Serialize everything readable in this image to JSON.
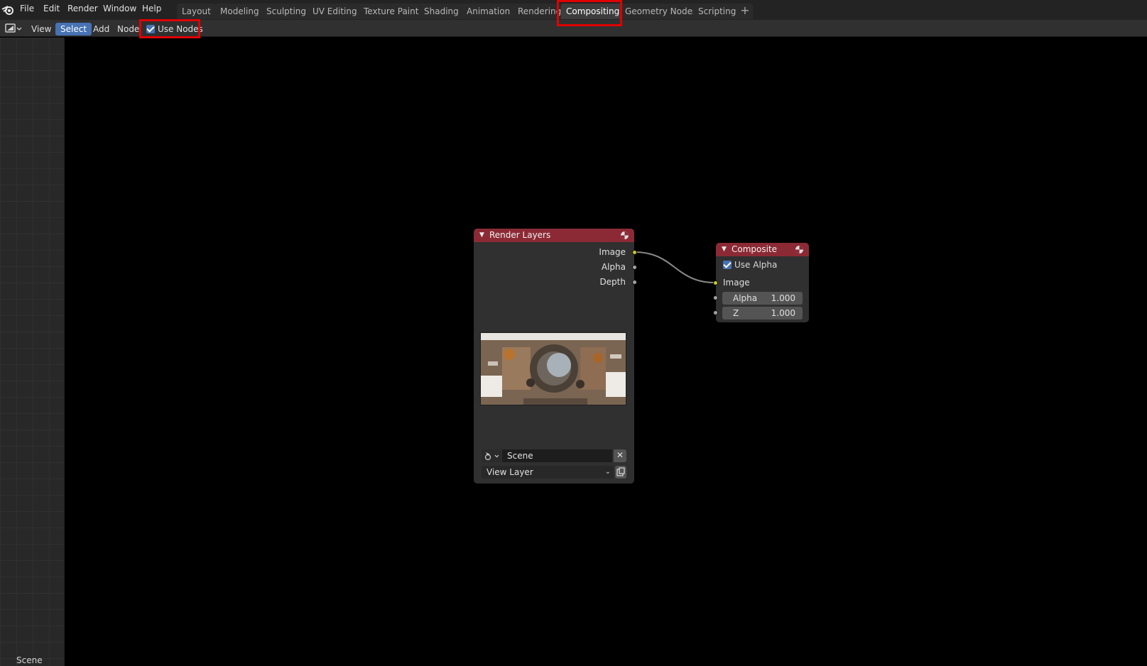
{
  "menu": [
    "File",
    "Edit",
    "Render",
    "Window",
    "Help"
  ],
  "workspaces": [
    "Layout",
    "Modeling",
    "Sculpting",
    "UV Editing",
    "Texture Paint",
    "Shading",
    "Animation",
    "Rendering",
    "Compositing",
    "Geometry Nodes",
    "Scripting"
  ],
  "active_workspace": "Compositing",
  "add_workspace": "+",
  "header": {
    "view": "View",
    "select": "Select",
    "add": "Add",
    "node": "Node",
    "use_nodes": "Use Nodes",
    "use_nodes_checked": true
  },
  "left_panel": {
    "scene_label": "Scene"
  },
  "render_layers": {
    "title": "Render Layers",
    "outputs": [
      "Image",
      "Alpha",
      "Depth"
    ],
    "scene_name": "Scene",
    "clear_symbol": "✕",
    "view_layer": "View Layer"
  },
  "composite": {
    "title": "Composite",
    "use_alpha_label": "Use Alpha",
    "use_alpha_checked": true,
    "image_input": "Image",
    "alpha_label": "Alpha",
    "alpha_value": "1.000",
    "z_label": "Z",
    "z_value": "1.000"
  },
  "colors": {
    "node_header": "#8b2a35",
    "accent_blue": "#4772b3",
    "socket_image": "#c7c729",
    "socket_value": "#a1a1a1",
    "highlight_red": "#e00000"
  }
}
